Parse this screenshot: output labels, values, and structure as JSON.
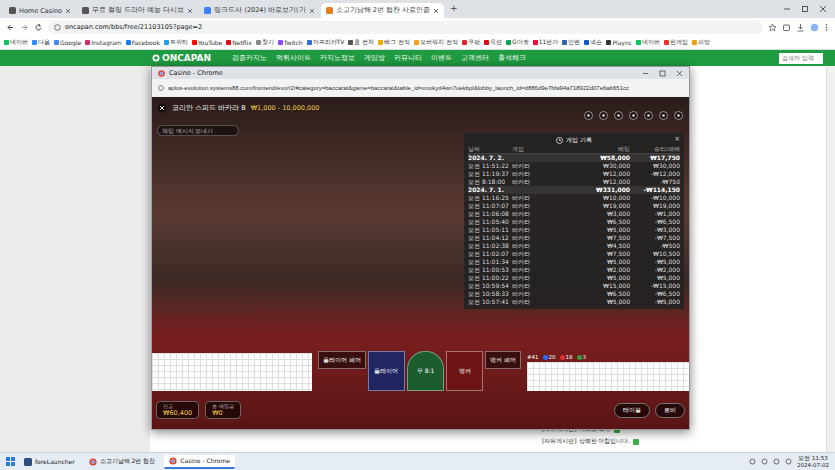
{
  "browser": {
    "tabs": [
      {
        "label": "Home Casino",
        "selected": false
      },
      {
        "label": "무료 컬링 드라마 예능 다시보",
        "selected": false
      },
      {
        "label": "링크드사 (2024) 바로보기(기",
        "selected": false
      },
      {
        "label": "소고기남해 2번 협찬 사로인증",
        "selected": true
      }
    ],
    "new_tab": "+",
    "address": "oncapan.com/bbs/free/21103105?page=2",
    "bookmarks": [
      {
        "label": "네이버",
        "color": "#03c75a"
      },
      {
        "label": "다음",
        "color": "#2d8cff"
      },
      {
        "label": "Google",
        "color": "#4285f4"
      },
      {
        "label": "Instagram",
        "color": "#d62976"
      },
      {
        "label": "Facebook",
        "color": "#1877f2"
      },
      {
        "label": "트위터",
        "color": "#1da1f2"
      },
      {
        "label": "YouTube",
        "color": "#ff0000"
      },
      {
        "label": "Netflix",
        "color": "#e50914"
      },
      {
        "label": "찾기",
        "color": "#888888"
      },
      {
        "label": "Twitch",
        "color": "#9146ff"
      },
      {
        "label": "아프리카TV",
        "color": "#2a6fdb"
      },
      {
        "label": "홈 컨처",
        "color": "#555555"
      },
      {
        "label": "배그 전적",
        "color": "#f2a900"
      },
      {
        "label": "오버워치 전적",
        "color": "#f99e1a"
      },
      {
        "label": "쿠팡",
        "color": "#e52528"
      },
      {
        "label": "옥션",
        "color": "#e60012"
      },
      {
        "label": "G마켓",
        "color": "#00a650"
      },
      {
        "label": "11번가",
        "color": "#ff0038"
      },
      {
        "label": "인벤",
        "color": "#2f5fb3"
      },
      {
        "label": "넥슨",
        "color": "#0a59c9"
      },
      {
        "label": "Plaync",
        "color": "#333333"
      },
      {
        "label": "네이버",
        "color": "#03c75a"
      },
      {
        "label": "한게임",
        "color": "#e9322a"
      },
      {
        "label": "피망",
        "color": "#f4a000"
      }
    ]
  },
  "page": {
    "logo": "ONCAPAN",
    "nav": [
      "검증카지노",
      "먹튀사이트",
      "카지노정보",
      "게임방",
      "커뮤니티",
      "이벤트",
      "고객센터",
      "출석체크"
    ],
    "search_placeholder": "검색어 입력",
    "board_items": [
      "[자유게시판] 지리오 역대",
      "[자유게시판] 상쾌한 아침입니다."
    ]
  },
  "popup": {
    "title": "Casino - Chrome",
    "url": "aplus-evolution.systems88.com/frontend/evo/r2/#category=baccarat&game=baccarat&table_id=onokyd4wn7uekbpl&lobby_launch_id=d886d9e7bfa94a718922d07e6ab651cc",
    "game": {
      "table_name": "코리안 스피드 바카라 B",
      "limits": "₩1,000 - 10,000,000",
      "chat_placeholder": "채팅 메시지 보내기"
    },
    "history": {
      "title": "게임 기록",
      "close": "×",
      "columns": [
        "날짜",
        "게임",
        "베팅",
        "승리/패배"
      ],
      "rows": [
        {
          "kind": "date",
          "cells": [
            "2024. 7. 2.",
            "₩58,000",
            "₩17,750"
          ]
        },
        {
          "kind": "bet",
          "cells": [
            "오전 11:51:22",
            "바카라",
            "₩30,000",
            "₩30,000"
          ]
        },
        {
          "kind": "bet",
          "cells": [
            "오전 11:19:37",
            "바카라",
            "₩12,000",
            "-₩12,000"
          ]
        },
        {
          "kind": "bet",
          "cells": [
            "오전 8:18:00",
            "바카라",
            "₩12,000",
            "-₩750"
          ]
        },
        {
          "kind": "date",
          "cells": [
            "2024. 7. 1.",
            "₩331,000",
            "-₩114,150"
          ]
        },
        {
          "kind": "bet",
          "cells": [
            "오전 11:16:25",
            "바카라",
            "₩10,000",
            "-₩10,000"
          ]
        },
        {
          "kind": "bet",
          "cells": [
            "오전 11:07:07",
            "바카라",
            "₩19,000",
            "₩19,000"
          ]
        },
        {
          "kind": "bet",
          "cells": [
            "오전 11:06:08",
            "바카라",
            "₩3,000",
            "-₩1,000"
          ]
        },
        {
          "kind": "bet",
          "cells": [
            "오전 11:05:40",
            "바카라",
            "₩6,500",
            "-₩6,500"
          ]
        },
        {
          "kind": "bet",
          "cells": [
            "오전 11:05:11",
            "바카라",
            "₩5,000",
            "-₩3,000"
          ]
        },
        {
          "kind": "bet",
          "cells": [
            "오전 11:04:12",
            "바카라",
            "₩7,500",
            "-₩7,500"
          ]
        },
        {
          "kind": "bet",
          "cells": [
            "오전 11:02:38",
            "바카라",
            "₩4,500",
            "-₩500"
          ]
        },
        {
          "kind": "bet",
          "cells": [
            "오전 11:02:07",
            "바카라",
            "₩7,500",
            "₩10,500"
          ]
        },
        {
          "kind": "bet",
          "cells": [
            "오전 11:01:34",
            "바카라",
            "₩5,000",
            "-₩5,000"
          ]
        },
        {
          "kind": "bet",
          "cells": [
            "오전 11:00:53",
            "바카라",
            "₩2,000",
            "-₩2,000"
          ]
        },
        {
          "kind": "bet",
          "cells": [
            "오전 11:00:22",
            "바카라",
            "₩5,000",
            "₩5,000"
          ]
        },
        {
          "kind": "bet",
          "cells": [
            "오전 10:59:54",
            "바카라",
            "₩15,000",
            "-₩15,000"
          ]
        },
        {
          "kind": "bet",
          "cells": [
            "오전 10:58:33",
            "바카라",
            "₩6,500",
            "-₩6,500"
          ]
        },
        {
          "kind": "bet",
          "cells": [
            "오전 10:57:41",
            "바카라",
            "₩5,000",
            "-₩5,000"
          ]
        }
      ]
    },
    "stats": {
      "round": "#41",
      "counts": [
        {
          "value": "20",
          "color": "#2f6bff"
        },
        {
          "value": "18",
          "color": "#e03131"
        },
        {
          "value": "3",
          "color": "#2f9e44"
        }
      ]
    },
    "bets": [
      {
        "label": "플레이어 페어",
        "kind": "pair"
      },
      {
        "label": "플레이어",
        "kind": "player"
      },
      {
        "label": "무 8:1",
        "kind": "tie"
      },
      {
        "label": "뱅커",
        "kind": "banker"
      },
      {
        "label": "뱅커 페어",
        "kind": "pair"
      }
    ],
    "balance": {
      "label": "잔고",
      "value": "₩60,400"
    },
    "total_bet": {
      "label": "총 베팅금",
      "value": "₩0"
    },
    "buttons": [
      "테이블",
      "로비"
    ]
  },
  "taskbar": {
    "items": [
      {
        "label": "foreLauncher",
        "active": false
      },
      {
        "label": "소고기남해 2번 협찬",
        "active": false
      },
      {
        "label": "Casino - Chrome",
        "active": true
      }
    ],
    "time": "오전 11:53",
    "date": "2024-07-02"
  }
}
